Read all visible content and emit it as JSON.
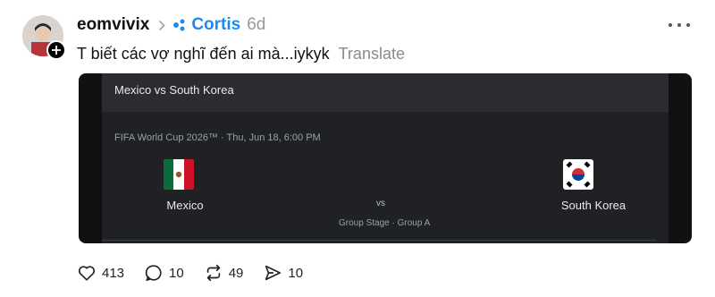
{
  "post": {
    "username": "eomvivix",
    "community": "Cortis",
    "time": "6d",
    "text": "T biết các vợ nghĩ đến ai mà...iykyk",
    "translate_label": "Translate"
  },
  "card": {
    "title": "Mexico vs South Korea",
    "meta": "FIFA World Cup 2026™ · Thu, Jun 18, 6:00 PM",
    "team_home": "Mexico",
    "team_away": "South Korea",
    "vs": "vs",
    "stage": "Group Stage · Group A"
  },
  "actions": {
    "likes": "413",
    "replies": "10",
    "reposts": "49",
    "shares": "10"
  },
  "icons": {
    "chevron": "chevron-right-icon",
    "community": "community-dots-icon",
    "more": "more-horizontal-icon",
    "like": "heart-icon",
    "reply": "comment-icon",
    "repost": "repost-icon",
    "share": "send-icon"
  },
  "colors": {
    "community": "#1d8cf0",
    "card_bg": "#202124"
  }
}
